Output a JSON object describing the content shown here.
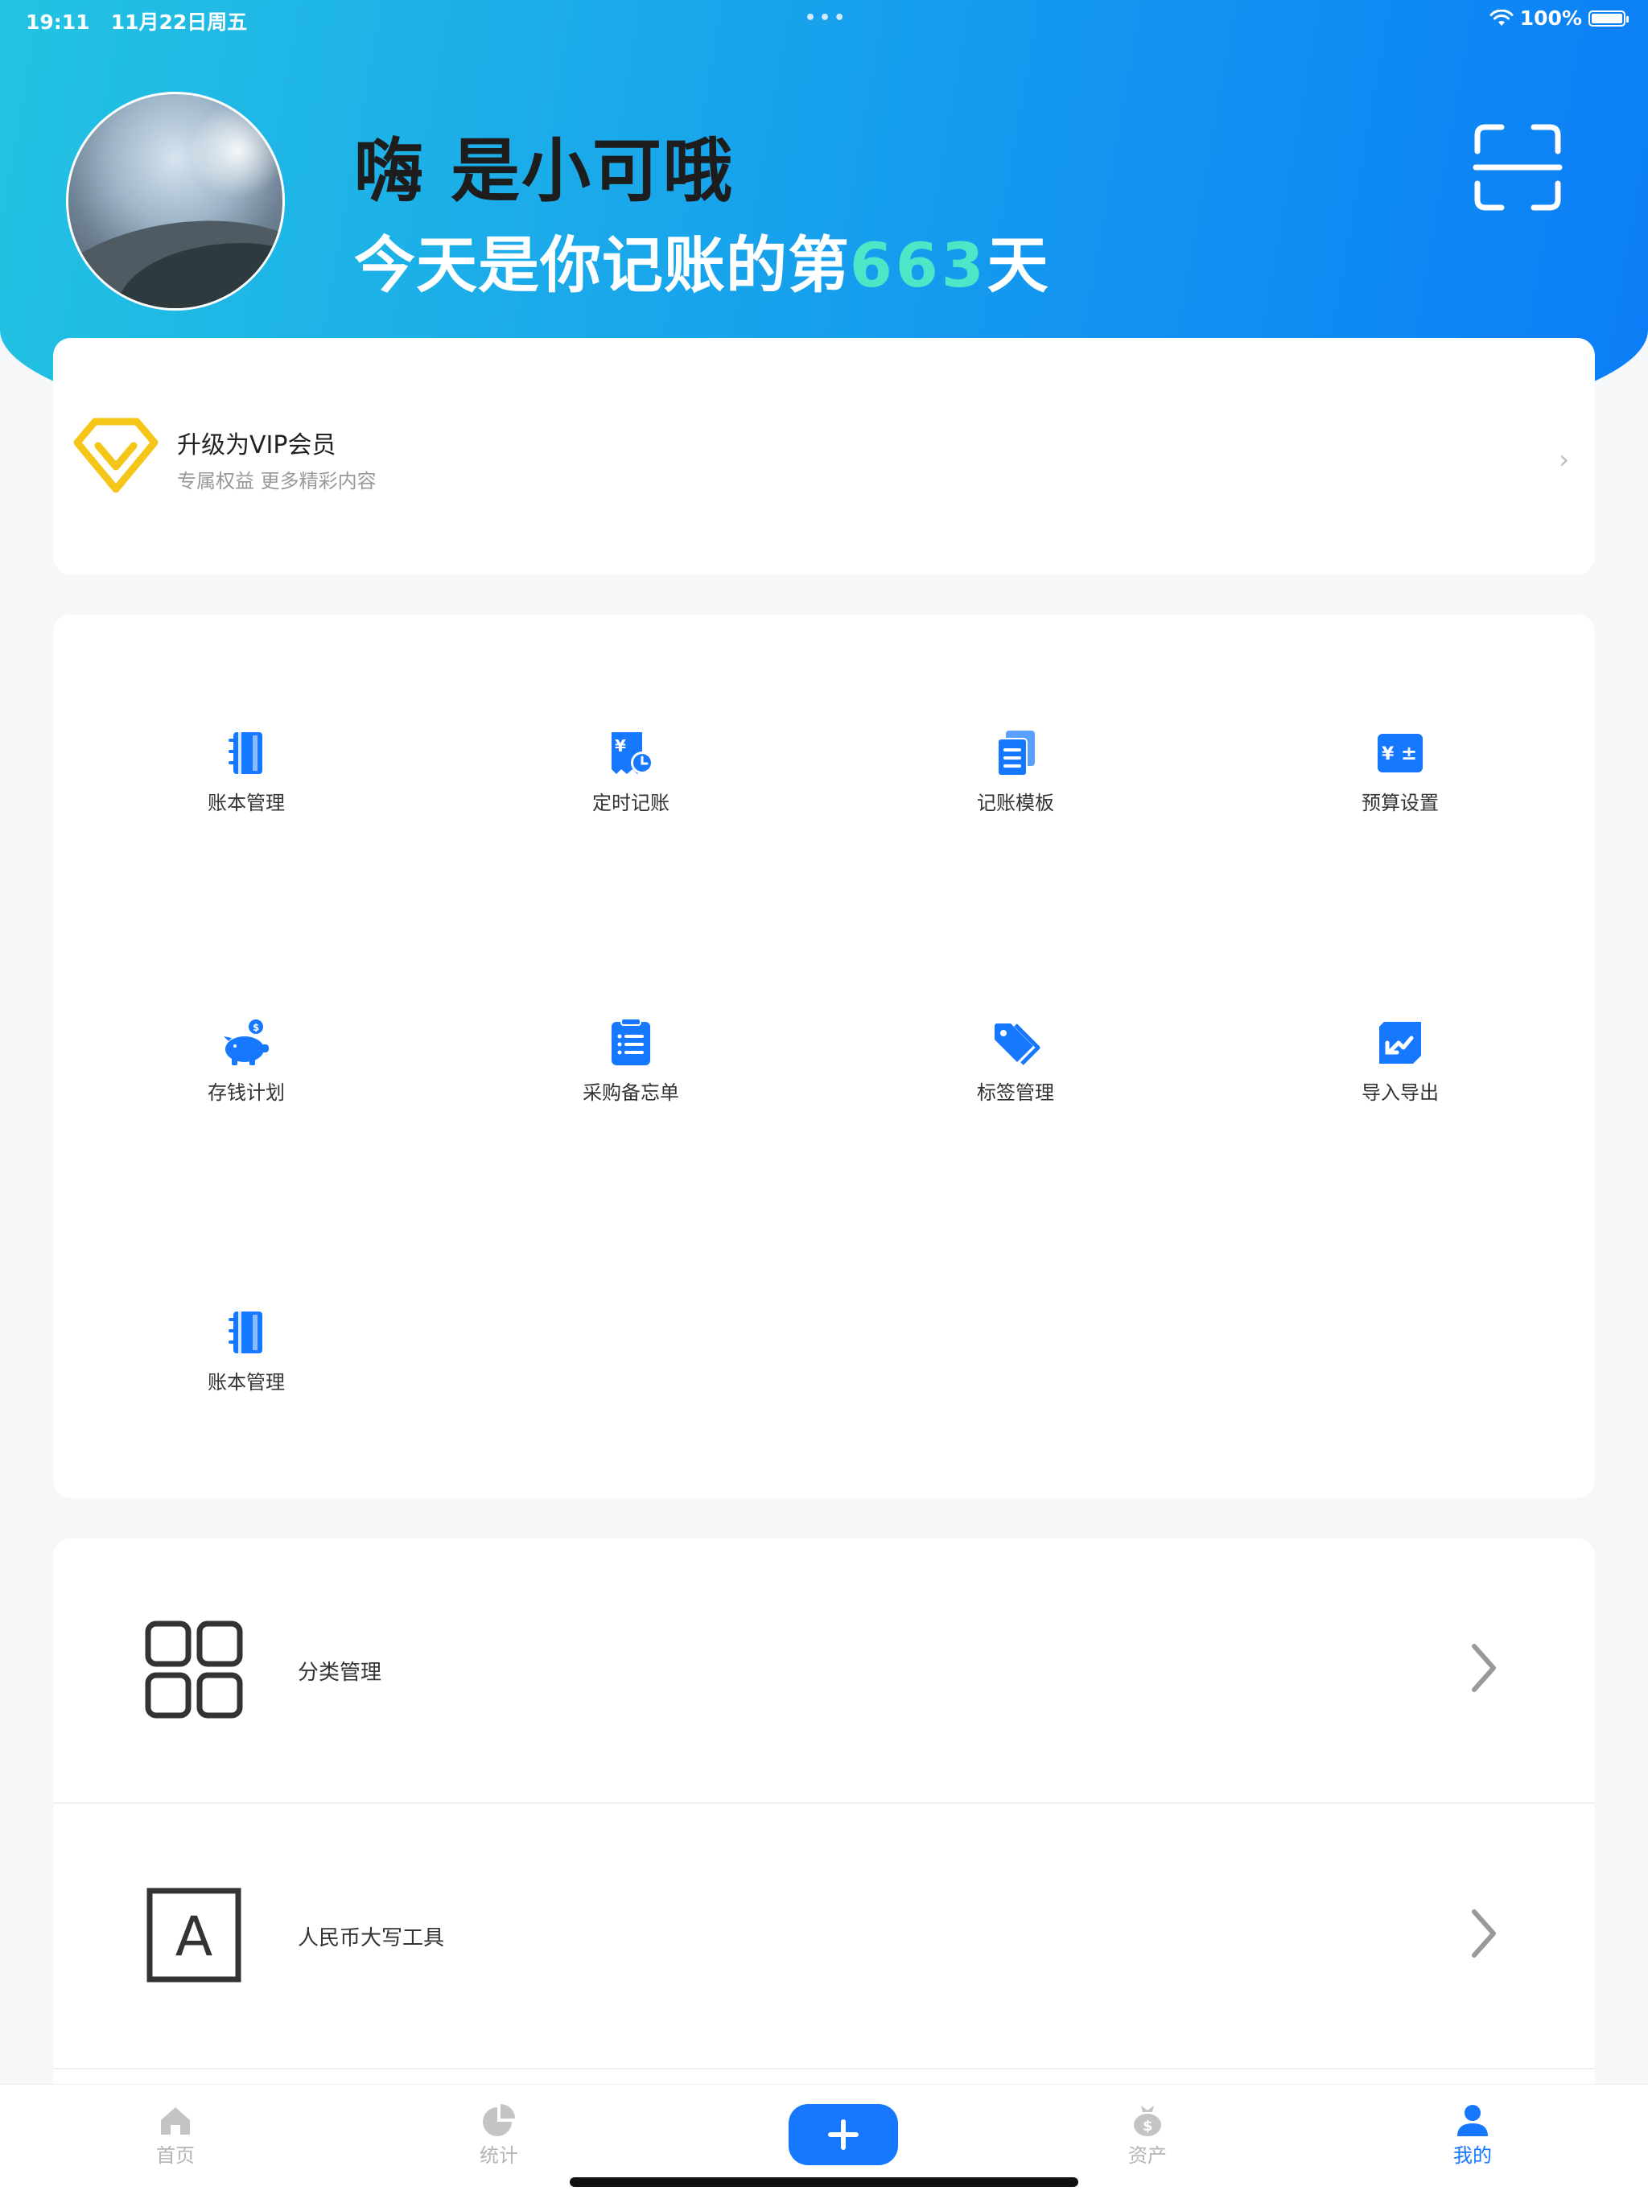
{
  "status_bar": {
    "time": "19:11",
    "date": "11月22日周五",
    "dots": "•••",
    "battery": "100%",
    "battery_level": 1.0
  },
  "header": {
    "greeting": "嗨 是小可哦",
    "subtitle_prefix": "今天是你记账的第",
    "days": "663",
    "subtitle_suffix": "天"
  },
  "vip": {
    "title": "升级为VIP会员",
    "subtitle": "专属权益 更多精彩内容",
    "chevron": "›"
  },
  "grid": {
    "items": [
      {
        "label": "账本管理",
        "icon": "ledger-book-icon"
      },
      {
        "label": "定时记账",
        "icon": "scheduled-bill-icon"
      },
      {
        "label": "记账模板",
        "icon": "template-docs-icon"
      },
      {
        "label": "预算设置",
        "icon": "budget-calculator-icon"
      },
      {
        "label": "存钱计划",
        "icon": "piggy-bank-icon"
      },
      {
        "label": "采购备忘单",
        "icon": "checklist-icon"
      },
      {
        "label": "标签管理",
        "icon": "tag-icon"
      },
      {
        "label": "导入导出",
        "icon": "import-export-icon"
      },
      {
        "label": "账本管理",
        "icon": "ledger-book-icon"
      }
    ]
  },
  "list": {
    "items": [
      {
        "label": "分类管理",
        "icon": "category-grid-icon"
      },
      {
        "label": "人民币大写工具",
        "icon": "letter-a-icon",
        "icon_glyph": "A"
      }
    ]
  },
  "tabs": {
    "items": [
      {
        "label": "首页",
        "icon": "home-icon"
      },
      {
        "label": "统计",
        "icon": "pie-chart-icon"
      },
      {
        "label": "资产",
        "icon": "money-bag-icon"
      },
      {
        "label": "我的",
        "icon": "person-icon",
        "active": true
      }
    ]
  },
  "colors": {
    "primary": "#1677ff",
    "gradient_start": "#23c3e2",
    "gradient_end": "#0b7df7",
    "days_highlight": "#4ee6c6",
    "vip_gold": "#f5c518"
  }
}
